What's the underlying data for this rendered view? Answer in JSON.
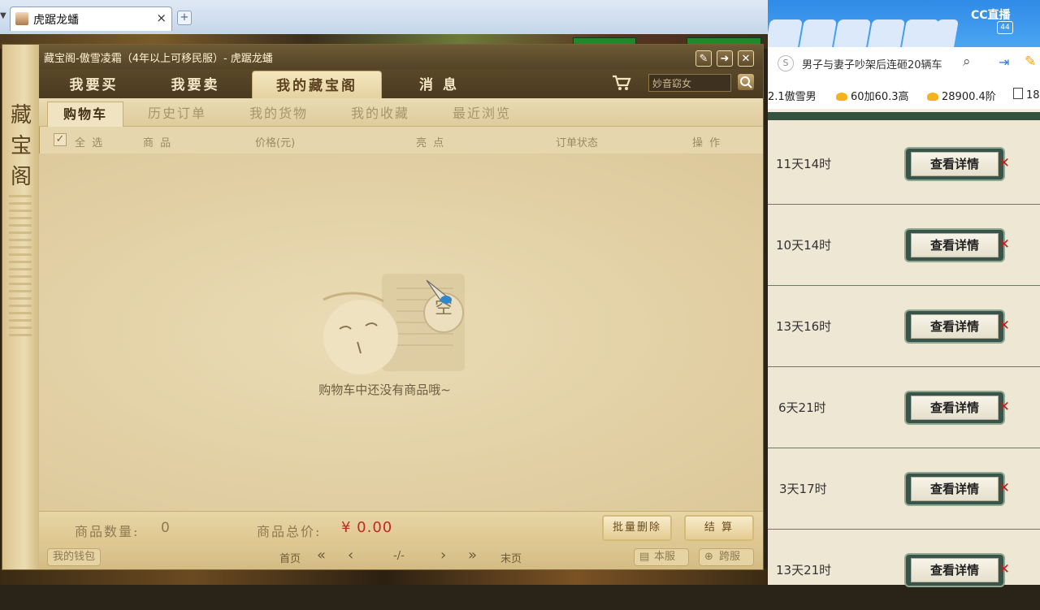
{
  "browser": {
    "tab_title": "虎踞龙蟠",
    "close": "×",
    "new_tab": "+"
  },
  "dialog": {
    "window_title": "藏宝阁-傲雪凌霜（4年以上可移民服）- 虎踞龙蟠",
    "sidebar_title": [
      "藏",
      "宝",
      "阁"
    ],
    "main_tabs": [
      "我要买",
      "我要卖",
      "我的藏宝阁",
      "消 息"
    ],
    "active_main_tab": "我的藏宝阁",
    "search_placeholder": "妙音窈女",
    "sub_tabs": [
      "购物车",
      "历史订单",
      "我的货物",
      "我的收藏",
      "最近浏览"
    ],
    "active_sub_tab": "购物车",
    "columns": [
      "全 选",
      "商 品",
      "价格(元)",
      "亮 点",
      "订单状态",
      "操 作"
    ],
    "select_all_checked": true,
    "empty_badge": "空",
    "empty_message": "购物车中还没有商品哦~",
    "footer": {
      "count_label": "商品数量:",
      "count_value": "0",
      "total_label": "商品总价:",
      "total_value": "¥ 0.00",
      "batch_delete": "批量删除",
      "checkout": "结 算"
    },
    "pager": {
      "wallet": "我的钱包",
      "first": "首页",
      "page": "-/-",
      "last": "末页",
      "this_server": "本服",
      "cross_server": "跨服"
    }
  },
  "right_panel": {
    "logo": "CC直播",
    "badge": "44",
    "search_query": "男子与妻子吵架后连砸20辆车",
    "hot_items": [
      "2.1傲雪男",
      "60加60.3高",
      "28900.4阶",
      "18"
    ],
    "rows": [
      {
        "time": "11天14时",
        "button": "查看详情"
      },
      {
        "time": "10天14时",
        "button": "查看详情"
      },
      {
        "time": "13天16时",
        "button": "查看详情"
      },
      {
        "time": "6天21时",
        "button": "查看详情"
      },
      {
        "time": "3天17时",
        "button": "查看详情"
      },
      {
        "time": "13天21时",
        "button": "查看详情"
      }
    ]
  }
}
